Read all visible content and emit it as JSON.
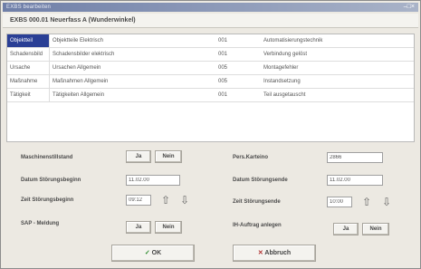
{
  "window": {
    "title": "EXBS bearbeiten",
    "controls": "–□×"
  },
  "header": {
    "title": "EXBS 000.01 Neuerfass A (Wunderwinkel)"
  },
  "grid": {
    "rows": [
      {
        "c0": "Objektteil",
        "c1": "Objektteile Elektrisch",
        "c2": "001",
        "c3": "Automatisierungstechnik",
        "selected": true
      },
      {
        "c0": "Schadensbild",
        "c1": "Schadensbilder elektrisch",
        "c2": "001",
        "c3": "Verbindung gelöst",
        "selected": false
      },
      {
        "c0": "Ursache",
        "c1": "Ursachen Allgemein",
        "c2": "005",
        "c3": "Montagefehler",
        "selected": false
      },
      {
        "c0": "Maßnahme",
        "c1": "Maßnahmen Allgemein",
        "c2": "005",
        "c3": "Instandsetzung",
        "selected": false
      },
      {
        "c0": "Tätigkeit",
        "c1": "Tätigkeiten Allgemein",
        "c2": "001",
        "c3": "Teil ausgetauscht",
        "selected": false
      }
    ]
  },
  "left": {
    "maschinenstillstand_label": "Maschinenstillstand",
    "ja": "Ja",
    "nein": "Nein",
    "datum_beginn_label": "Datum Störungsbeginn",
    "datum_beginn_value": "11.02.00",
    "zeit_beginn_label": "Zeit Störungsbeginn",
    "zeit_beginn_value": "09:12",
    "sap_label": "SAP - Meldung",
    "sap_ja": "Ja",
    "sap_nein": "Nein"
  },
  "right": {
    "pers_label": "Pers.Karteino",
    "pers_value": "2866",
    "datum_ende_label": "Datum Störungsende",
    "datum_ende_value": "11.02.00",
    "zeit_ende_label": "Zeit Störungsende",
    "zeit_ende_value": "10:00",
    "auftrag_label": "IH-Auftrag anlegen",
    "auftrag_ja": "Ja",
    "auftrag_nein": "Nein"
  },
  "actions": {
    "ok": "OK",
    "abbruch": "Abbruch"
  },
  "icons": {
    "up": "arrow-up-icon",
    "down": "arrow-down-icon"
  }
}
